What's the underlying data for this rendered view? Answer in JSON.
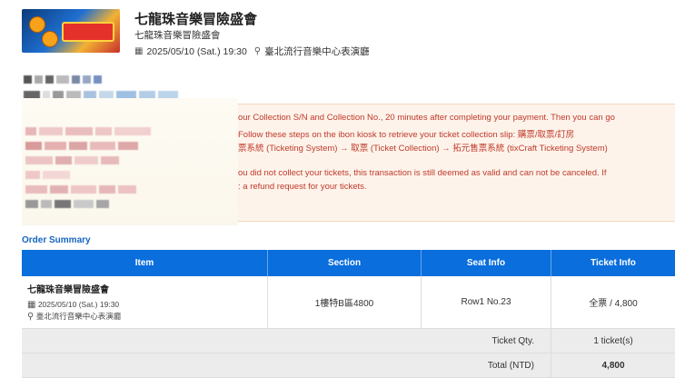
{
  "event": {
    "title": "七龍珠音樂冒險盛會",
    "subtitle": "七龍珠音樂冒險盛會",
    "datetime": "2025/05/10 (Sat.) 19:30",
    "venue": "臺北流行音樂中心表演廳"
  },
  "notice": {
    "lines": [
      "our Collection S/N and Collection No., 20 minutes after completing your payment. Then you can go",
      "Follow these steps on the ibon kiosk to retrieve your ticket collection slip: 購票/取票/訂房",
      "票系統 (Ticketing System) → 取票 (Ticket Collection) → 拓元售票系統 (tixCraft Ticketing System)",
      "ou did not collect your tickets, this transaction is still deemed as valid and can not be canceled. If",
      ": a refund request for your tickets."
    ],
    "color": "#c0392b"
  },
  "order_summary": {
    "title": "Order Summary",
    "columns": [
      "Item",
      "Section",
      "Seat Info",
      "Ticket Info"
    ],
    "item": {
      "name": "七龍珠音樂冒險盛會",
      "datetime": "2025/05/10 (Sat.) 19:30",
      "venue": "臺北流行音樂中心表演廳"
    },
    "section": "1樓特B區4800",
    "seat": "Row1 No.23",
    "ticket": "全票 / 4,800",
    "qty_label": "Ticket Qty.",
    "qty_value": "1 ticket(s)",
    "total_label": "Total (NTD)",
    "total_value": "4,800"
  },
  "colors": {
    "header_blue": "#0a6edc",
    "link_blue": "#1565c0",
    "total_red": "#d32f2f"
  }
}
